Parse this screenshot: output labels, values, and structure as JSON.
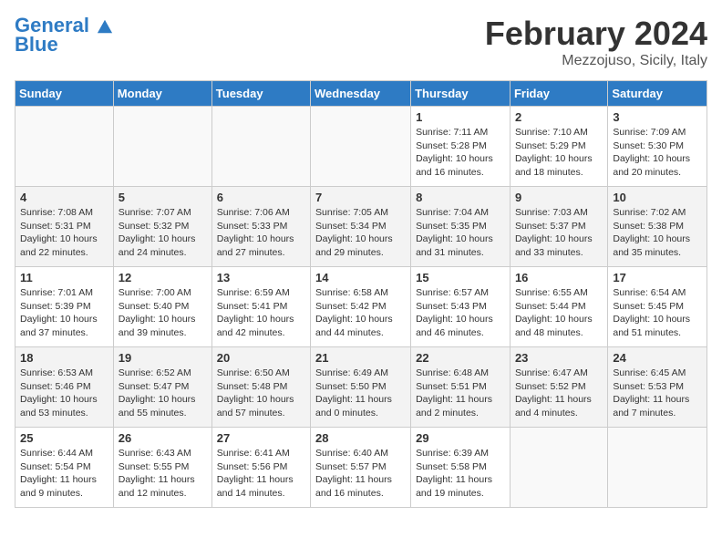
{
  "header": {
    "logo_line1": "General",
    "logo_line2": "Blue",
    "month": "February 2024",
    "location": "Mezzojuso, Sicily, Italy"
  },
  "days_of_week": [
    "Sunday",
    "Monday",
    "Tuesday",
    "Wednesday",
    "Thursday",
    "Friday",
    "Saturday"
  ],
  "weeks": [
    [
      {
        "num": "",
        "info": ""
      },
      {
        "num": "",
        "info": ""
      },
      {
        "num": "",
        "info": ""
      },
      {
        "num": "",
        "info": ""
      },
      {
        "num": "1",
        "info": "Sunrise: 7:11 AM\nSunset: 5:28 PM\nDaylight: 10 hours\nand 16 minutes."
      },
      {
        "num": "2",
        "info": "Sunrise: 7:10 AM\nSunset: 5:29 PM\nDaylight: 10 hours\nand 18 minutes."
      },
      {
        "num": "3",
        "info": "Sunrise: 7:09 AM\nSunset: 5:30 PM\nDaylight: 10 hours\nand 20 minutes."
      }
    ],
    [
      {
        "num": "4",
        "info": "Sunrise: 7:08 AM\nSunset: 5:31 PM\nDaylight: 10 hours\nand 22 minutes."
      },
      {
        "num": "5",
        "info": "Sunrise: 7:07 AM\nSunset: 5:32 PM\nDaylight: 10 hours\nand 24 minutes."
      },
      {
        "num": "6",
        "info": "Sunrise: 7:06 AM\nSunset: 5:33 PM\nDaylight: 10 hours\nand 27 minutes."
      },
      {
        "num": "7",
        "info": "Sunrise: 7:05 AM\nSunset: 5:34 PM\nDaylight: 10 hours\nand 29 minutes."
      },
      {
        "num": "8",
        "info": "Sunrise: 7:04 AM\nSunset: 5:35 PM\nDaylight: 10 hours\nand 31 minutes."
      },
      {
        "num": "9",
        "info": "Sunrise: 7:03 AM\nSunset: 5:37 PM\nDaylight: 10 hours\nand 33 minutes."
      },
      {
        "num": "10",
        "info": "Sunrise: 7:02 AM\nSunset: 5:38 PM\nDaylight: 10 hours\nand 35 minutes."
      }
    ],
    [
      {
        "num": "11",
        "info": "Sunrise: 7:01 AM\nSunset: 5:39 PM\nDaylight: 10 hours\nand 37 minutes."
      },
      {
        "num": "12",
        "info": "Sunrise: 7:00 AM\nSunset: 5:40 PM\nDaylight: 10 hours\nand 39 minutes."
      },
      {
        "num": "13",
        "info": "Sunrise: 6:59 AM\nSunset: 5:41 PM\nDaylight: 10 hours\nand 42 minutes."
      },
      {
        "num": "14",
        "info": "Sunrise: 6:58 AM\nSunset: 5:42 PM\nDaylight: 10 hours\nand 44 minutes."
      },
      {
        "num": "15",
        "info": "Sunrise: 6:57 AM\nSunset: 5:43 PM\nDaylight: 10 hours\nand 46 minutes."
      },
      {
        "num": "16",
        "info": "Sunrise: 6:55 AM\nSunset: 5:44 PM\nDaylight: 10 hours\nand 48 minutes."
      },
      {
        "num": "17",
        "info": "Sunrise: 6:54 AM\nSunset: 5:45 PM\nDaylight: 10 hours\nand 51 minutes."
      }
    ],
    [
      {
        "num": "18",
        "info": "Sunrise: 6:53 AM\nSunset: 5:46 PM\nDaylight: 10 hours\nand 53 minutes."
      },
      {
        "num": "19",
        "info": "Sunrise: 6:52 AM\nSunset: 5:47 PM\nDaylight: 10 hours\nand 55 minutes."
      },
      {
        "num": "20",
        "info": "Sunrise: 6:50 AM\nSunset: 5:48 PM\nDaylight: 10 hours\nand 57 minutes."
      },
      {
        "num": "21",
        "info": "Sunrise: 6:49 AM\nSunset: 5:50 PM\nDaylight: 11 hours\nand 0 minutes."
      },
      {
        "num": "22",
        "info": "Sunrise: 6:48 AM\nSunset: 5:51 PM\nDaylight: 11 hours\nand 2 minutes."
      },
      {
        "num": "23",
        "info": "Sunrise: 6:47 AM\nSunset: 5:52 PM\nDaylight: 11 hours\nand 4 minutes."
      },
      {
        "num": "24",
        "info": "Sunrise: 6:45 AM\nSunset: 5:53 PM\nDaylight: 11 hours\nand 7 minutes."
      }
    ],
    [
      {
        "num": "25",
        "info": "Sunrise: 6:44 AM\nSunset: 5:54 PM\nDaylight: 11 hours\nand 9 minutes."
      },
      {
        "num": "26",
        "info": "Sunrise: 6:43 AM\nSunset: 5:55 PM\nDaylight: 11 hours\nand 12 minutes."
      },
      {
        "num": "27",
        "info": "Sunrise: 6:41 AM\nSunset: 5:56 PM\nDaylight: 11 hours\nand 14 minutes."
      },
      {
        "num": "28",
        "info": "Sunrise: 6:40 AM\nSunset: 5:57 PM\nDaylight: 11 hours\nand 16 minutes."
      },
      {
        "num": "29",
        "info": "Sunrise: 6:39 AM\nSunset: 5:58 PM\nDaylight: 11 hours\nand 19 minutes."
      },
      {
        "num": "",
        "info": ""
      },
      {
        "num": "",
        "info": ""
      }
    ]
  ]
}
